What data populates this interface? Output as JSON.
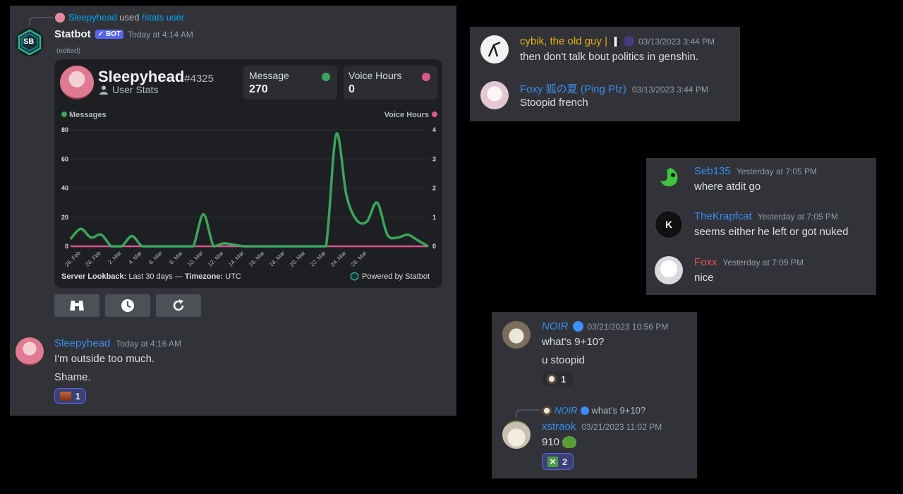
{
  "colors": {
    "link": "#00a8fc",
    "accent": "#5865f2",
    "messages_series": "#3ba55d",
    "voice_series": "#d9568e"
  },
  "statbot_message": {
    "reply_user": "Sleepyhead",
    "reply_used": "used",
    "reply_command": "/stats user",
    "author": "Statbot",
    "bot_badge": "BOT",
    "bot_check": "✓",
    "avatar_text": "SB",
    "timestamp": "Today at 4:14 AM",
    "edited": "(edited)",
    "card": {
      "username": "Sleepyhead",
      "discriminator": "#4325",
      "subtitle": "User Stats",
      "stats": [
        {
          "label": "Message",
          "value": "270"
        },
        {
          "label": "Voice Hours",
          "value": "0"
        }
      ],
      "footer_lookback_label": "Server Lookback:",
      "footer_lookback_value": "Last 30 days —",
      "footer_timezone_label": "Timezone:",
      "footer_timezone_value": "UTC",
      "powered_by": "Powered by Statbot"
    },
    "buttons": [
      {
        "icon": "binoculars-icon"
      },
      {
        "icon": "clock-icon"
      },
      {
        "icon": "refresh-icon"
      }
    ]
  },
  "chart_data": {
    "type": "line",
    "legend_left": "Messages",
    "legend_right": "Voice Hours",
    "y_left_ticks": [
      "0",
      "20",
      "40",
      "60",
      "80"
    ],
    "y_right_ticks": [
      "0",
      "1",
      "2",
      "3",
      "4"
    ],
    "ylim_left": [
      0,
      80
    ],
    "ylim_right": [
      0,
      4
    ],
    "x_tick_labels": [
      "26. Feb",
      "28. Feb",
      "2. Mar",
      "4. Mar",
      "6. Mar",
      "8. Mar",
      "10. Mar",
      "12. Mar",
      "14. Mar",
      "16. Mar",
      "18. Mar",
      "20. Mar",
      "22. Mar",
      "24. Mar",
      "26. Mar"
    ],
    "grid": true,
    "series": [
      {
        "name": "Messages",
        "axis": "left",
        "values": [
          5,
          12,
          6,
          8,
          0,
          0,
          7,
          0,
          0,
          0,
          0,
          0,
          0,
          22,
          0,
          2,
          1,
          0,
          0,
          0,
          0,
          0,
          0,
          0,
          0,
          0,
          77,
          35,
          18,
          17,
          30,
          8,
          6,
          8,
          4,
          0
        ]
      },
      {
        "name": "Voice Hours",
        "axis": "right",
        "values": [
          0,
          0,
          0,
          0,
          0,
          0,
          0,
          0,
          0,
          0,
          0,
          0,
          0,
          0,
          0,
          0,
          0,
          0,
          0,
          0,
          0,
          0,
          0,
          0,
          0,
          0,
          0,
          0,
          0,
          0,
          0,
          0,
          0,
          0,
          0,
          0
        ]
      }
    ]
  },
  "sleepy_message": {
    "author": "Sleepyhead",
    "timestamp": "Today at 4:16 AM",
    "lines": [
      "I'm outside too much.",
      "Shame."
    ],
    "reaction_count": "1"
  },
  "panel2": {
    "messages": [
      {
        "author": "cybik, the old guy |",
        "timestamp": "03/13/2023 3:44 PM",
        "text": "then don't talk bout politics in genshin."
      },
      {
        "author": "Foxy 狐の夏 (Ping Plz)",
        "timestamp": "03/13/2023 3:44 PM",
        "text": "Stoopid french"
      }
    ]
  },
  "panel3": {
    "messages": [
      {
        "author": "Seb135",
        "timestamp": "Yesterday at 7:05 PM",
        "text": "where atdit go"
      },
      {
        "author": "TheKrapfcat",
        "timestamp": "Yesterday at 7:05 PM",
        "text": "seems either he left or got nuked",
        "avatar_letter": "K"
      },
      {
        "author": "Foxx",
        "timestamp": "Yesterday at 7:09 PM",
        "text": "nice"
      }
    ]
  },
  "panel4": {
    "noir": {
      "author": "NOIR",
      "timestamp": "03/21/2023 10:56 PM",
      "lines": [
        "what's 9+10?",
        "u stoopid"
      ],
      "reaction_count": "1"
    },
    "xstraok": {
      "reply_author": "NOIR",
      "reply_text": "what's 9+10?",
      "author": "xstraok",
      "timestamp": "03/21/2023 11:02 PM",
      "text": "910",
      "reaction_count": "2"
    }
  }
}
